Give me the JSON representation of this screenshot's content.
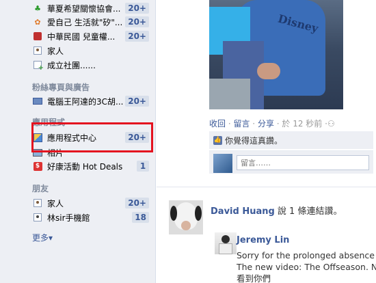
{
  "sidebar": {
    "groups": [
      {
        "label": "華夏希望關懷協會...",
        "badge": "20+",
        "icon": "sprout-icon"
      },
      {
        "label": "愛自己 生活就\"矽\"...",
        "badge": "20+",
        "icon": "flower-icon"
      },
      {
        "label": "中華民國 兒童權...",
        "badge": "20+",
        "icon": "gift-icon"
      },
      {
        "label": "家人",
        "badge": "",
        "icon": "family-icon"
      },
      {
        "label": "成立社團......",
        "badge": "",
        "icon": "create-group-icon"
      }
    ],
    "pages_heading": "粉絲專頁與廣告",
    "pages": [
      {
        "label": "電腦王阿達的3C胡...",
        "badge": "20+",
        "icon": "computer-icon"
      }
    ],
    "apps_heading": "應用程式",
    "apps": [
      {
        "label": "應用程式中心",
        "badge": "20+",
        "icon": "app-center-icon"
      },
      {
        "label": "相片",
        "badge": "",
        "icon": "photos-icon"
      },
      {
        "label": "好康活動 Hot Deals",
        "badge": "1",
        "icon": "deals-icon"
      }
    ],
    "friends_heading": "朋友",
    "friends": [
      {
        "label": "家人",
        "badge": "20+",
        "icon": "family-list-icon"
      },
      {
        "label": "林sir手機館",
        "badge": "18",
        "icon": "list-icon"
      }
    ],
    "more_label": "更多▾"
  },
  "feed": {
    "photo_logo": "Disney",
    "actions": {
      "collapse": "收回",
      "comment": "留言",
      "share": "分享",
      "time": "於 12 秒前"
    },
    "separator": " · ",
    "like_text": "你覺得這真讚。",
    "comment_placeholder": "留言……",
    "story": {
      "name": "David Huang",
      "text": " 說 1 條連結讚。"
    },
    "reply": {
      "name": "Jeremy Lin",
      "line1": "Sorry for the prolonged absence",
      "line2": "The new video: The Offseason. N",
      "line3": "看到你們"
    }
  }
}
